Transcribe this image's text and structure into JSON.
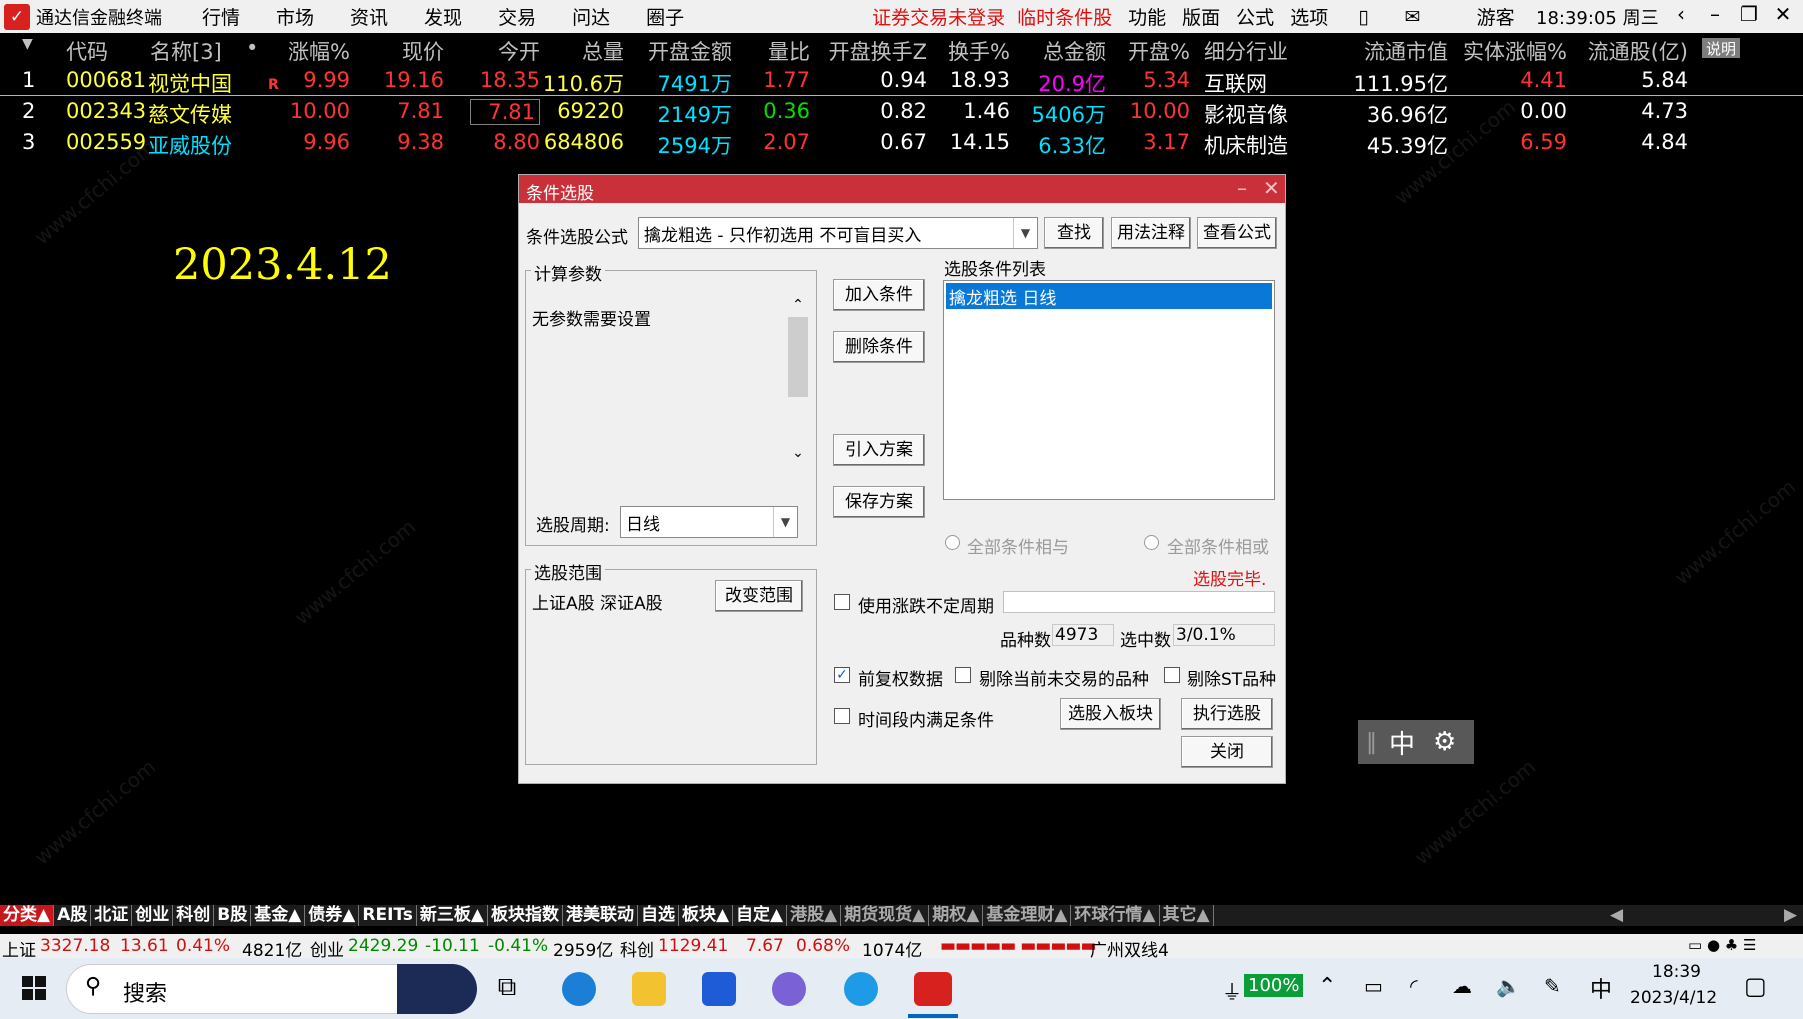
{
  "app": {
    "title": "通达信金融终端",
    "menu": [
      "行情",
      "市场",
      "资讯",
      "发现",
      "交易",
      "问达",
      "圈子"
    ],
    "warning": "证券交易未登录",
    "temp_condition": "临时条件股",
    "items": [
      "功能",
      "版面",
      "公式",
      "选项"
    ],
    "guest": "游客",
    "clock": "18:39:05 周三"
  },
  "table": {
    "headers": [
      "代码",
      "名称[3]",
      "•",
      "涨幅%",
      "现价",
      "今开",
      "总量",
      "开盘金额",
      "量比",
      "开盘换手Z",
      "换手%",
      "总金额",
      "开盘%",
      "细分行业",
      "流通市值",
      "实体涨幅%",
      "流通股(亿)"
    ],
    "note": "说明",
    "rows": [
      {
        "idx": "1",
        "code": "000681",
        "name": "视觉中国",
        "flag": "R",
        "chg": "9.99",
        "price": "19.16",
        "open": "18.35",
        "vol": "110.6万",
        "open_amt": "7491万",
        "vr": "1.77",
        "open_turn": "0.94",
        "turn": "18.93",
        "amt": "20.9亿",
        "open_pct": "5.34",
        "industry": "互联网",
        "mcap": "111.95亿",
        "body_chg": "4.41",
        "float": "5.84"
      },
      {
        "idx": "2",
        "code": "002343",
        "name": "慈文传媒",
        "flag": "",
        "chg": "10.00",
        "price": "7.81",
        "open": "7.81",
        "vol": "69220",
        "open_amt": "2149万",
        "vr": "0.36",
        "open_turn": "0.82",
        "turn": "1.46",
        "amt": "5406万",
        "open_pct": "10.00",
        "industry": "影视音像",
        "mcap": "36.96亿",
        "body_chg": "0.00",
        "float": "4.73"
      },
      {
        "idx": "3",
        "code": "002559",
        "name": "亚威股份",
        "flag": "",
        "chg": "9.96",
        "price": "9.38",
        "open": "8.80",
        "vol": "684806",
        "open_amt": "2594万",
        "vr": "2.07",
        "open_turn": "0.67",
        "turn": "14.15",
        "amt": "6.33亿",
        "open_pct": "3.17",
        "industry": "机床制造",
        "mcap": "45.39亿",
        "body_chg": "6.59",
        "float": "4.84"
      }
    ]
  },
  "date_overlay": "2023.4.12",
  "dialog": {
    "title": "条件选股",
    "formula_label": "条件选股公式",
    "formula_value": "擒龙粗选   - 只作初选用 不可盲目买入",
    "btn_find": "查找",
    "btn_usage": "用法注释",
    "btn_view": "查看公式",
    "params_legend": "计算参数",
    "params_text": "无参数需要设置",
    "period_label": "选股周期:",
    "period_value": "日线",
    "range_legend": "选股范围",
    "range_text": "上证A股 深证A股",
    "btn_change_range": "改变范围",
    "btn_add": "加入条件",
    "btn_delete": "删除条件",
    "btn_import": "引入方案",
    "btn_save": "保存方案",
    "cond_list_label": "选股条件列表",
    "cond_items": [
      "擒龙粗选  日线"
    ],
    "radio_and": "全部条件相与",
    "radio_or": "全部条件相或",
    "status": "选股完毕.",
    "chk_variable_period": "使用涨跌不定周期",
    "count_label": "品种数",
    "count_value": "4973",
    "selected_label": "选中数",
    "selected_value": "3/0.1%",
    "chk_forward_adj": "前复权数据",
    "chk_exclude_no_trade": "剔除当前未交易的品种",
    "chk_exclude_st": "剔除ST品种",
    "chk_time_period": "时间段内满足条件",
    "btn_to_block": "选股入板块",
    "btn_execute": "执行选股",
    "btn_close": "关闭"
  },
  "ime_widget": {
    "mode": "中"
  },
  "board_tabs": [
    "分类▲",
    "A股",
    "北证",
    "创业",
    "科创",
    "B股",
    "基金▲",
    "债券▲",
    "REITs",
    "新三板▲",
    "板块指数",
    "港美联动",
    "自选",
    "板块▲",
    "自定▲",
    "港股▲",
    "期货现货▲",
    "期权▲",
    "基金理财▲",
    "环球行情▲",
    "其它▲"
  ],
  "ticker": {
    "sh_label": "上证",
    "sh_value": "3327.18",
    "sh_chg": "13.61",
    "sh_pct": "0.41%",
    "sh_amt": "4821亿",
    "cy_label": "创业",
    "cy_value": "2429.29",
    "cy_chg": "-10.11",
    "cy_pct": "-0.41%",
    "cy_amt": "2959亿",
    "kc_label": "科创",
    "kc_value": "1129.41",
    "kc_chg": "7.67",
    "kc_pct": "0.68%",
    "kc_amt": "1074亿",
    "server": "广州双线4"
  },
  "taskbar": {
    "search": "搜索",
    "battery": "100%",
    "ime": "中",
    "time": "18:39",
    "date": "2023/4/12"
  },
  "colors": {
    "accent": "#c9303a",
    "up": "#ff3333",
    "down": "#00e000",
    "price_yellow": "#ffff3c"
  }
}
